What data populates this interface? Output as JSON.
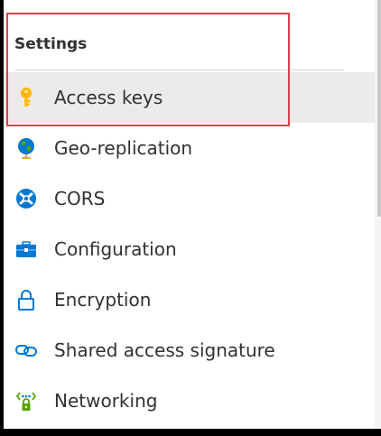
{
  "section": {
    "title": "Settings"
  },
  "nav": {
    "items": [
      {
        "label": "Access keys",
        "icon": "key-icon",
        "selected": true
      },
      {
        "label": "Geo-replication",
        "icon": "globe-icon"
      },
      {
        "label": "CORS",
        "icon": "cors-icon"
      },
      {
        "label": "Configuration",
        "icon": "configuration-icon"
      },
      {
        "label": "Encryption",
        "icon": "lock-icon"
      },
      {
        "label": "Shared access signature",
        "icon": "link-icon"
      },
      {
        "label": "Networking",
        "icon": "networking-icon"
      }
    ]
  },
  "colors": {
    "highlight": "#d9434c",
    "selected_bg": "#edebe9",
    "icon_blue": "#0078d4",
    "key_yellow": "#ffb900",
    "network_green": "#57a300"
  }
}
